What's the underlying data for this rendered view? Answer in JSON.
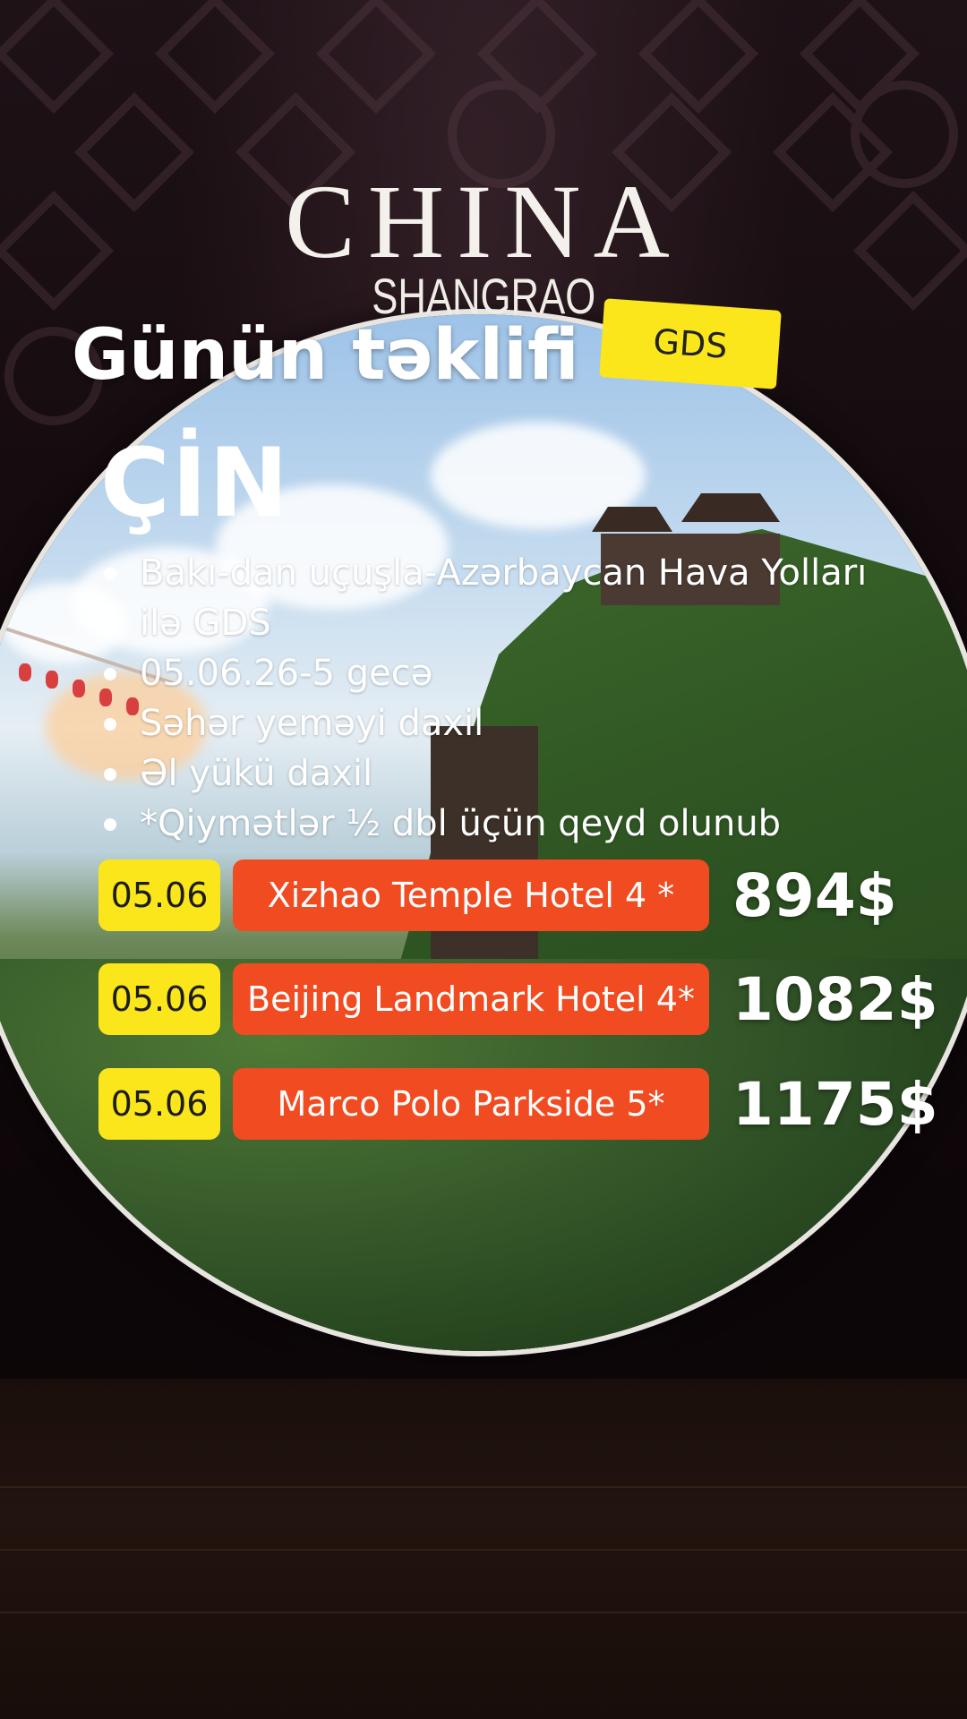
{
  "brand": {
    "title": "CHINA",
    "subtitle": "SHANGRAO"
  },
  "headline": "Günün təklifi",
  "tag": "GDS",
  "country": "ÇİN",
  "bullets": [
    "Bakı-dan uçuşla-Azərbaycan Hava Yolları ilə GDS",
    "05.06.26-5 gecə",
    "Səhər yeməyi daxil",
    "Əl yükü daxil",
    "*Qiymətlər ½ dbl üçün qeyd olunub"
  ],
  "offers": [
    {
      "date": "05.06",
      "hotel": "Xizhao Temple Hotel 4 *",
      "price": "894$"
    },
    {
      "date": "05.06",
      "hotel": "Beijing Landmark Hotel 4*",
      "price": "1082$"
    },
    {
      "date": "05.06",
      "hotel": "Marco Polo Parkside 5*",
      "price": "1175$"
    }
  ],
  "colors": {
    "accent_yellow": "#fbe51b",
    "accent_orange": "#f04b21",
    "background": "#140a0d"
  }
}
